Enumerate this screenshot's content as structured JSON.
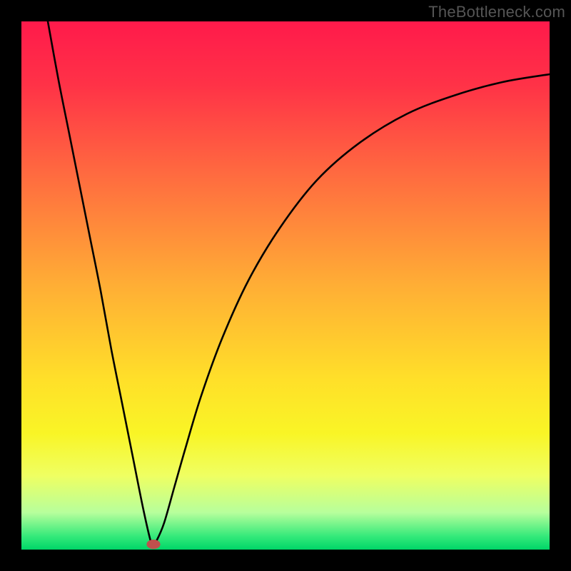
{
  "watermark": "TheBottleneck.com",
  "chart_data": {
    "type": "line",
    "title": "",
    "xlabel": "",
    "ylabel": "",
    "xlim": [
      0,
      100
    ],
    "ylim": [
      0,
      100
    ],
    "background_gradient": {
      "stops": [
        {
          "offset": 0.0,
          "color": "#ff1a4b"
        },
        {
          "offset": 0.12,
          "color": "#ff3247"
        },
        {
          "offset": 0.3,
          "color": "#ff6e3f"
        },
        {
          "offset": 0.5,
          "color": "#ffae35"
        },
        {
          "offset": 0.68,
          "color": "#ffe029"
        },
        {
          "offset": 0.78,
          "color": "#f9f526"
        },
        {
          "offset": 0.86,
          "color": "#efff62"
        },
        {
          "offset": 0.93,
          "color": "#b7ff9c"
        },
        {
          "offset": 0.975,
          "color": "#34e97a"
        },
        {
          "offset": 1.0,
          "color": "#00d668"
        }
      ]
    },
    "curve": {
      "points": [
        {
          "x": 5.0,
          "y": 100.0
        },
        {
          "x": 7.0,
          "y": 89.0
        },
        {
          "x": 9.0,
          "y": 79.0
        },
        {
          "x": 11.0,
          "y": 69.0
        },
        {
          "x": 13.0,
          "y": 59.0
        },
        {
          "x": 15.0,
          "y": 49.0
        },
        {
          "x": 17.0,
          "y": 38.0
        },
        {
          "x": 19.0,
          "y": 28.0
        },
        {
          "x": 21.0,
          "y": 18.0
        },
        {
          "x": 23.0,
          "y": 8.0
        },
        {
          "x": 24.5,
          "y": 1.5
        },
        {
          "x": 25.0,
          "y": 1.0
        },
        {
          "x": 25.5,
          "y": 1.5
        },
        {
          "x": 27.0,
          "y": 5.0
        },
        {
          "x": 29.0,
          "y": 12.0
        },
        {
          "x": 31.0,
          "y": 19.0
        },
        {
          "x": 34.0,
          "y": 29.0
        },
        {
          "x": 38.0,
          "y": 40.0
        },
        {
          "x": 43.0,
          "y": 51.0
        },
        {
          "x": 49.0,
          "y": 61.0
        },
        {
          "x": 56.0,
          "y": 70.0
        },
        {
          "x": 64.0,
          "y": 77.0
        },
        {
          "x": 73.0,
          "y": 82.5
        },
        {
          "x": 82.0,
          "y": 86.0
        },
        {
          "x": 91.0,
          "y": 88.5
        },
        {
          "x": 100.0,
          "y": 90.0
        }
      ]
    },
    "marker": {
      "x": 25.0,
      "y": 1.0,
      "rx": 1.3,
      "ry": 0.9,
      "color": "#c0504d"
    }
  }
}
